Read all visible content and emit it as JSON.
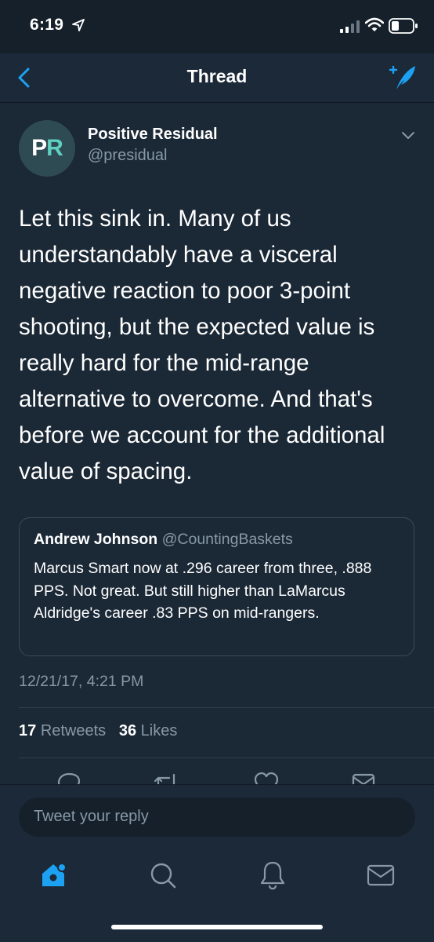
{
  "status_bar": {
    "time": "6:19",
    "icons": [
      "location-arrow-icon",
      "signal-icon",
      "wifi-icon",
      "battery-icon"
    ]
  },
  "nav": {
    "title": "Thread",
    "back_icon": "chevron-left-icon",
    "compose_icon": "compose-tweet-icon",
    "accent_color": "#1da1f2"
  },
  "tweet": {
    "avatar_initials": [
      "P",
      "R"
    ],
    "author_name": "Positive Residual",
    "author_handle": "@presidual",
    "body": "Let this sink in. Many of us understandably have a visceral negative reaction to poor 3-point shooting, but the expected value is really hard for the mid-range alternative to overcome. And that's before we account for the additional value of spacing.",
    "quoted": {
      "name": "Andrew Johnson",
      "handle": "@CountingBaskets",
      "text": "Marcus Smart now at .296 career from three, .888 PPS. Not great. But still higher than LaMarcus Aldridge's career .83 PPS on mid-rangers."
    },
    "timestamp": "12/21/17, 4:21 PM",
    "stats": {
      "retweets_count": "17",
      "retweets_label": "Retweets",
      "likes_count": "36",
      "likes_label": "Likes"
    },
    "actions": [
      "reply-icon",
      "retweet-icon",
      "like-icon",
      "share-icon"
    ]
  },
  "reply_bar": {
    "placeholder": "Tweet your reply"
  },
  "tab_bar": {
    "items": [
      "home-icon",
      "search-icon",
      "notifications-icon",
      "messages-icon"
    ],
    "active": "home-icon"
  }
}
